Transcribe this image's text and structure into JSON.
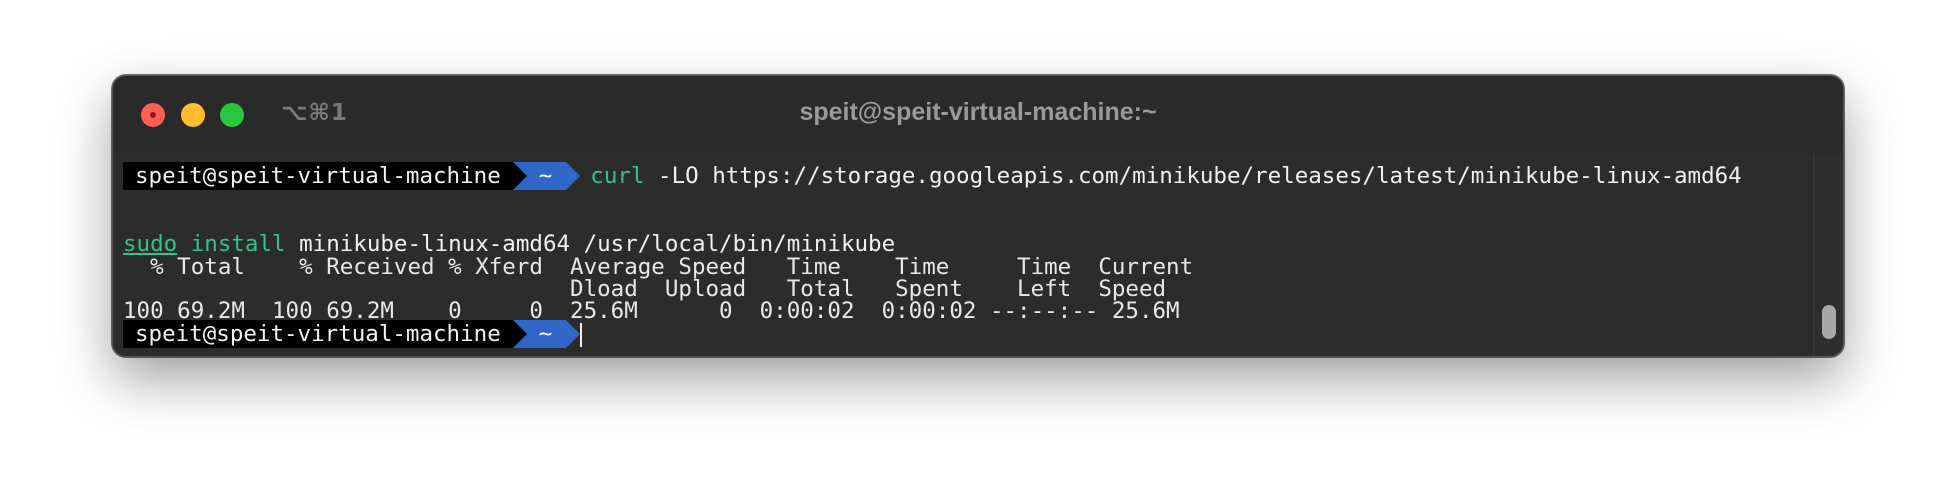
{
  "window": {
    "shortcut": "⌥⌘1",
    "title": "speit@speit-virtual-machine:~"
  },
  "prompt": {
    "user_host": "speit@speit-virtual-machine",
    "dir": "~"
  },
  "lines": {
    "cmd1_name": "curl",
    "cmd1_args": " -LO https://storage.googleapis.com/minikube/releases/latest/minikube-linux-amd64",
    "cmd2_sudo": "sudo",
    "cmd2_install": "install",
    "cmd2_args": " minikube-linux-amd64 /usr/local/bin/minikube",
    "header1": "  % Total    % Received % Xferd  Average Speed   Time    Time     Time  Current",
    "header2": "                                 Dload  Upload   Total   Spent    Left  Speed",
    "progress": "100 69.2M  100 69.2M    0     0  25.6M      0  0:00:02  0:00:02 --:--:-- 25.6M"
  },
  "colors": {
    "command_green": "#35c28b",
    "prompt_user_bg": "#000000",
    "prompt_dir_bg": "#2f66c8",
    "terminal_bg": "#2c2c2c"
  }
}
